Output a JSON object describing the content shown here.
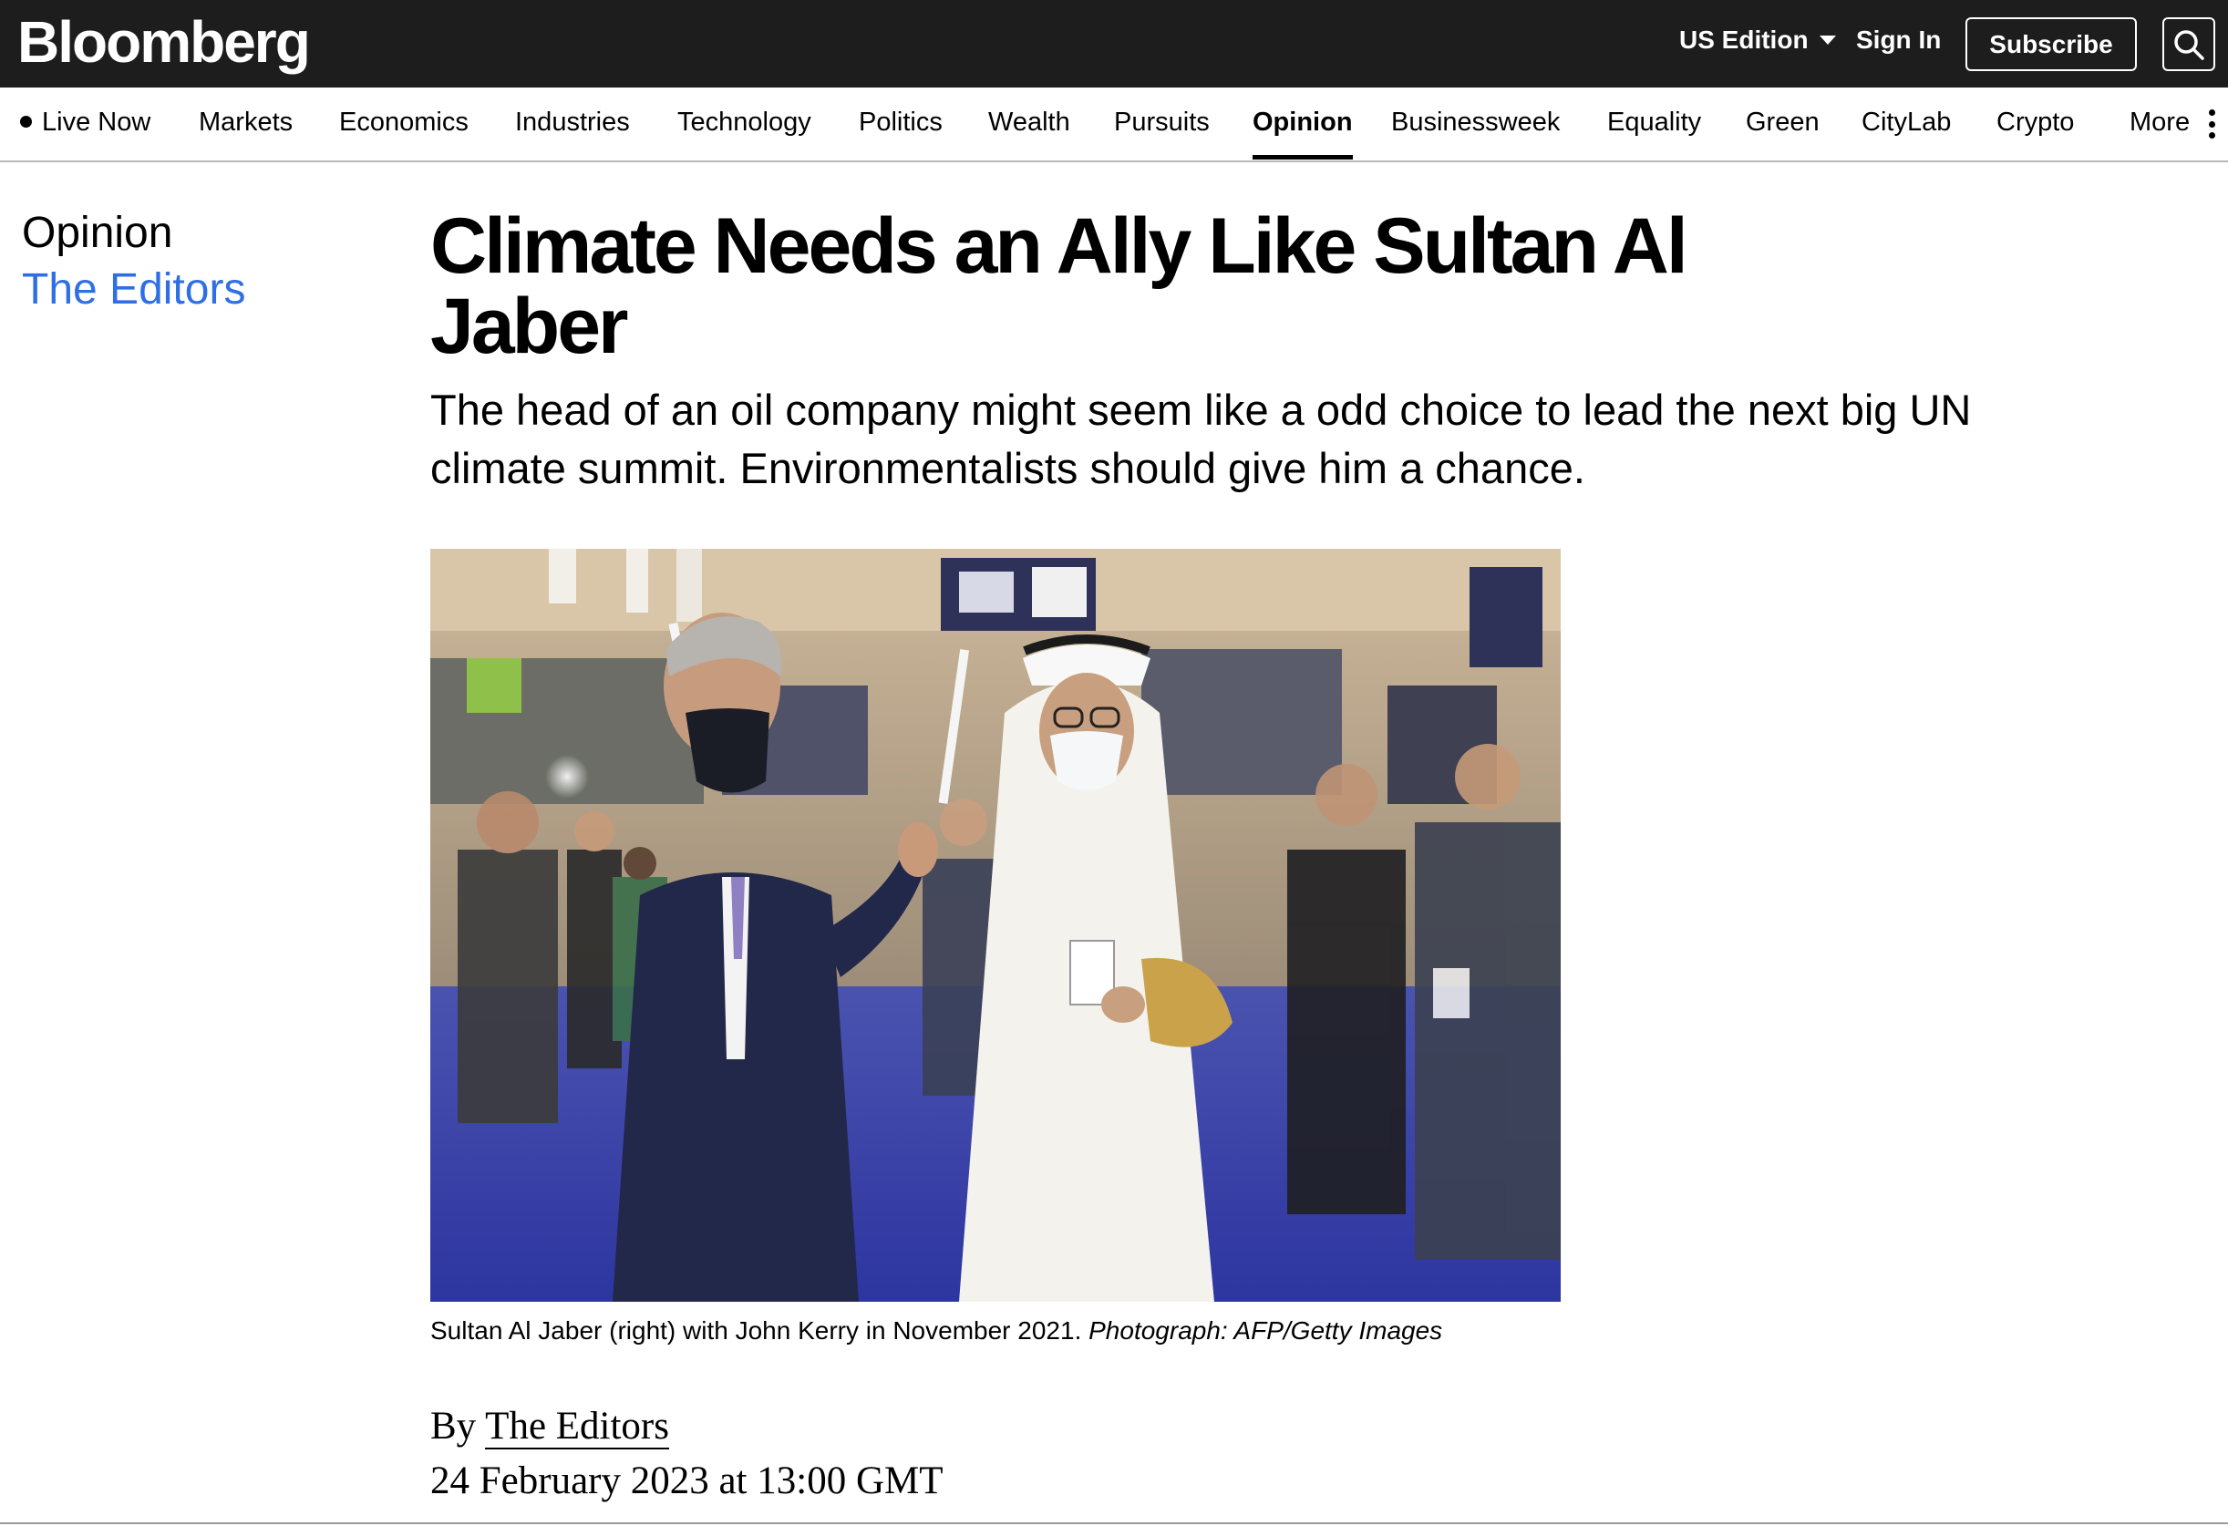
{
  "brand": {
    "logo_text": "Bloomberg"
  },
  "header": {
    "edition_label": "US Edition",
    "signin_label": "Sign In",
    "subscribe_label": "Subscribe",
    "search_icon": "search-icon"
  },
  "nav": {
    "items": [
      {
        "label": "Live Now"
      },
      {
        "label": "Markets"
      },
      {
        "label": "Economics"
      },
      {
        "label": "Industries"
      },
      {
        "label": "Technology"
      },
      {
        "label": "Politics"
      },
      {
        "label": "Wealth"
      },
      {
        "label": "Pursuits"
      },
      {
        "label": "Opinion",
        "active": true
      },
      {
        "label": "Businessweek"
      },
      {
        "label": "Equality"
      },
      {
        "label": "Green"
      },
      {
        "label": "CityLab"
      },
      {
        "label": "Crypto"
      },
      {
        "label": "More"
      }
    ],
    "more_icon": "kebab-menu-icon"
  },
  "section": {
    "name": "Opinion",
    "author": "The Editors"
  },
  "article": {
    "headline": "Climate Needs an Ally Like Sultan Al Jaber",
    "dek": "The head of an oil company might seem like a odd choice to lead the next big UN climate summit. Environmentalists should give him a chance.",
    "caption": "Sultan Al Jaber (right) with John Kerry in November 2021.",
    "credit": "Photograph: AFP/Getty Images",
    "byline_prefix": "By",
    "byline_author": "The Editors",
    "dateline": "24 February 2023 at 13:00 GMT"
  },
  "colors": {
    "topbar_bg": "#1d1d1d",
    "link_blue": "#2f6fe4",
    "carpet_blue": "#3a45b8"
  }
}
